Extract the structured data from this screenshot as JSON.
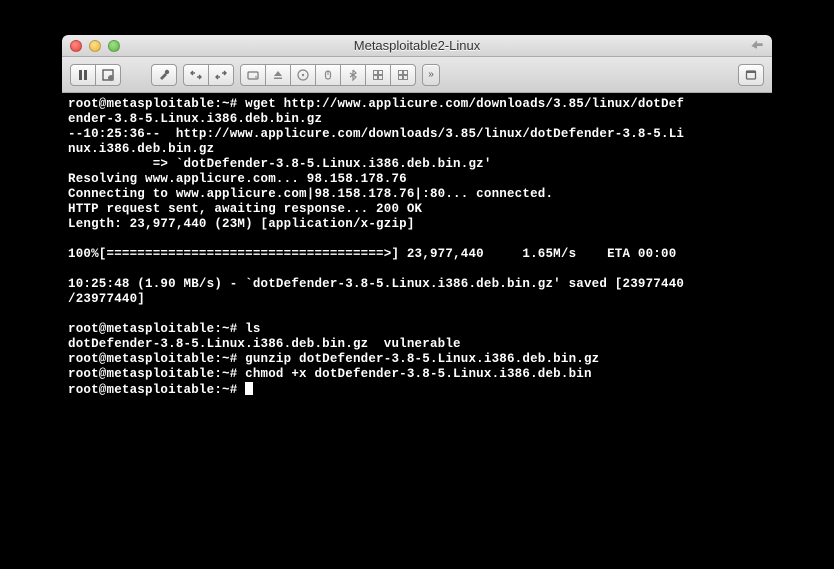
{
  "window": {
    "title": "Metasploitable2-Linux"
  },
  "toolbar": {
    "pause": "pause-icon",
    "snapshot": "snapshot-icon",
    "wrench": "settings-icon",
    "swap_left": "swap-left-icon",
    "swap_right": "swap-right-icon",
    "hdd": "harddrive-icon",
    "eject": "eject-icon",
    "disc": "disc-icon",
    "mouse": "mouse-icon",
    "bluetooth": "bluetooth-icon",
    "grid1": "grid-icon",
    "grid2": "grid-icon",
    "chevron": "»",
    "windowed": "windowed-icon"
  },
  "terminal": {
    "lines": [
      "root@metasploitable:~# wget http://www.applicure.com/downloads/3.85/linux/dotDef",
      "ender-3.8-5.Linux.i386.deb.bin.gz",
      "--10:25:36--  http://www.applicure.com/downloads/3.85/linux/dotDefender-3.8-5.Li",
      "nux.i386.deb.bin.gz",
      "           => `dotDefender-3.8-5.Linux.i386.deb.bin.gz'",
      "Resolving www.applicure.com... 98.158.178.76",
      "Connecting to www.applicure.com|98.158.178.76|:80... connected.",
      "HTTP request sent, awaiting response... 200 OK",
      "Length: 23,977,440 (23M) [application/x-gzip]",
      "",
      "100%[====================================>] 23,977,440     1.65M/s    ETA 00:00",
      "",
      "10:25:48 (1.90 MB/s) - `dotDefender-3.8-5.Linux.i386.deb.bin.gz' saved [23977440",
      "/23977440]",
      "",
      "root@metasploitable:~# ls",
      "dotDefender-3.8-5.Linux.i386.deb.bin.gz  vulnerable",
      "root@metasploitable:~# gunzip dotDefender-3.8-5.Linux.i386.deb.bin.gz",
      "root@metasploitable:~# chmod +x dotDefender-3.8-5.Linux.i386.deb.bin",
      "root@metasploitable:~# "
    ]
  }
}
